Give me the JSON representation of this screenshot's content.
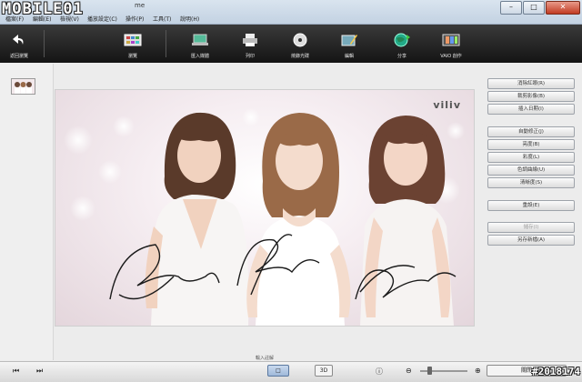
{
  "titlebar": {
    "logo_text": "MOBILE01",
    "app_title": "me",
    "menu": [
      "檔案(F)",
      "編輯(E)",
      "檢視(V)",
      "播放設定(C)",
      "操作(P)",
      "工具(T)",
      "說明(H)"
    ]
  },
  "toolbar": {
    "items": [
      {
        "id": "back",
        "label": "返回瀏覽",
        "icon": "back-arrow-icon"
      },
      {
        "id": "view",
        "label": "瀏覽",
        "icon": "grid-view-icon"
      },
      {
        "id": "import",
        "label": "匯入媒體",
        "icon": "import-media-icon"
      },
      {
        "id": "print",
        "label": "列印",
        "icon": "printer-icon"
      },
      {
        "id": "burn",
        "label": "燒錄光碟",
        "icon": "disc-icon"
      },
      {
        "id": "edit",
        "label": "編輯",
        "icon": "edit-picture-icon"
      },
      {
        "id": "share",
        "label": "分享",
        "icon": "globe-share-icon"
      },
      {
        "id": "vaio",
        "label": "VAIO 創作",
        "icon": "film-strip-icon"
      }
    ]
  },
  "photo": {
    "brand": "viliv"
  },
  "caption": "輸入註解",
  "right_panel": {
    "buttons": [
      {
        "label": "消除紅眼(R)",
        "disabled": false
      },
      {
        "label": "裁剪影像(B)",
        "disabled": false
      },
      {
        "label": "插入日期(I)",
        "disabled": false
      },
      {
        "label": "自動修正(J)",
        "disabled": false
      },
      {
        "label": "亮度(B)",
        "disabled": false
      },
      {
        "label": "彩度(L)",
        "disabled": false
      },
      {
        "label": "色調曲線(U)",
        "disabled": false
      },
      {
        "label": "清晰度(S)",
        "disabled": false
      },
      {
        "label": "重設(E)",
        "disabled": false
      },
      {
        "label": "儲存(I)",
        "disabled": true
      },
      {
        "label": "另存新檔(A)",
        "disabled": false
      }
    ]
  },
  "bottombar": {
    "modes": [
      "□",
      "3D"
    ],
    "close_label": "關閉",
    "watermark": "#2018174"
  }
}
